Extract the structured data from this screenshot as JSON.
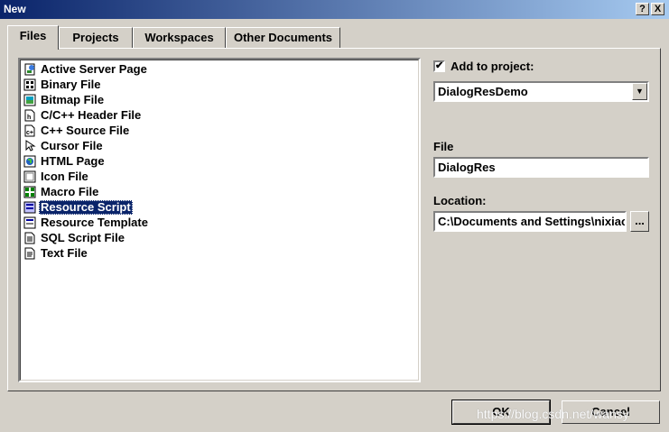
{
  "window": {
    "title": "New",
    "help_button": "?",
    "close_button": "X"
  },
  "tabs": [
    {
      "label": "Files",
      "active": true
    },
    {
      "label": "Projects",
      "active": false
    },
    {
      "label": "Workspaces",
      "active": false
    },
    {
      "label": "Other Documents",
      "active": false
    }
  ],
  "files": [
    {
      "label": "Active Server Page",
      "icon": "asp-file-icon"
    },
    {
      "label": "Binary File",
      "icon": "binary-file-icon"
    },
    {
      "label": "Bitmap File",
      "icon": "bitmap-file-icon"
    },
    {
      "label": "C/C++ Header File",
      "icon": "header-file-icon"
    },
    {
      "label": "C++ Source File",
      "icon": "source-file-icon"
    },
    {
      "label": "Cursor File",
      "icon": "cursor-file-icon"
    },
    {
      "label": "HTML Page",
      "icon": "html-page-icon"
    },
    {
      "label": "Icon File",
      "icon": "icon-file-icon"
    },
    {
      "label": "Macro File",
      "icon": "macro-file-icon"
    },
    {
      "label": "Resource Script",
      "icon": "resource-script-icon",
      "selected": true
    },
    {
      "label": "Resource Template",
      "icon": "resource-template-icon"
    },
    {
      "label": "SQL Script File",
      "icon": "sql-file-icon"
    },
    {
      "label": "Text File",
      "icon": "text-file-icon"
    }
  ],
  "add_to_project": {
    "label": "Add to project:",
    "checked": true,
    "check_mark": "✔",
    "value": "DialogResDemo"
  },
  "file_field": {
    "label": "File",
    "value": "DialogRes"
  },
  "location_field": {
    "label": "Location:",
    "value": "C:\\Documents and Settings\\nixiaoqin",
    "browse_label": "..."
  },
  "buttons": {
    "ok": "OK",
    "cancel": "Cancel"
  },
  "watermark": "https://blog.csdn.net/wansy"
}
